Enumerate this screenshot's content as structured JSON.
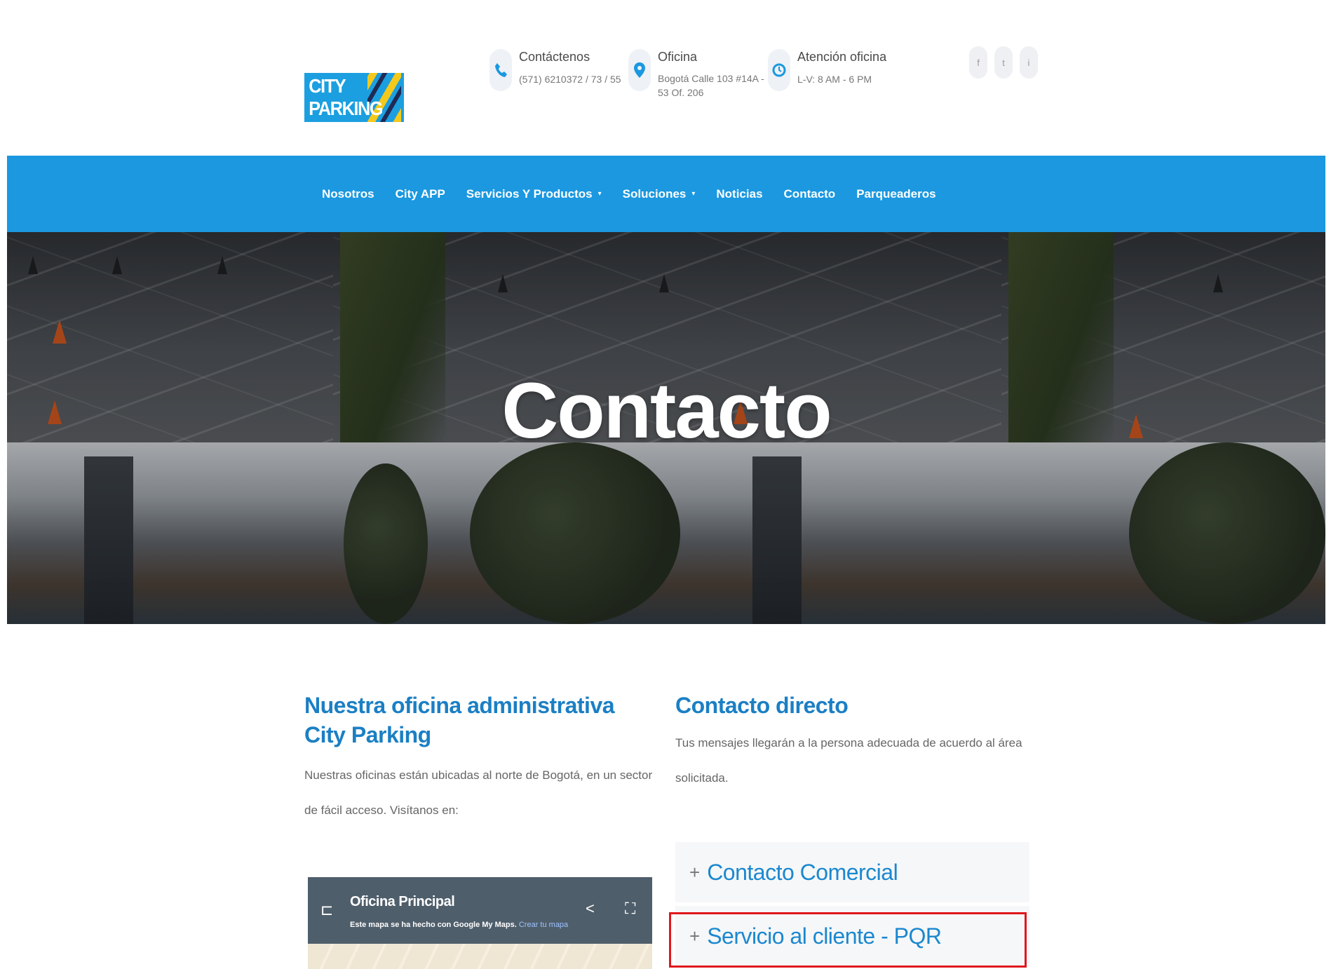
{
  "brand": {
    "logo_text": "CITY PARKING"
  },
  "header": {
    "contact": {
      "title": "Contáctenos",
      "value": "(571) 6210372 / 73 / 55"
    },
    "office": {
      "title": "Oficina",
      "value_line1": "Bogotá Calle 103 #14A -",
      "value_line2": "53 Of. 206"
    },
    "hours": {
      "title": "Atención oficina",
      "value": "L-V: 8 AM - 6 PM"
    },
    "social": {
      "facebook": "f",
      "twitter": "t",
      "instagram": "i"
    }
  },
  "nav": {
    "items": [
      {
        "label": "Nosotros"
      },
      {
        "label": "City APP"
      },
      {
        "label": "Servicios Y Productos",
        "caret": "▾"
      },
      {
        "label": "Soluciones",
        "caret": "▾"
      },
      {
        "label": "Noticias"
      },
      {
        "label": "Contacto",
        "active": true
      },
      {
        "label": "Parqueaderos"
      }
    ]
  },
  "hero": {
    "title": "Contacto"
  },
  "left": {
    "heading": "Nuestra oficina administrativa City Parking",
    "text": "Nuestras oficinas están ubicadas al norte de Bogotá, en un sector de fácil acceso. Visítanos en:",
    "map": {
      "title": "Oficina Principal",
      "note": "Este mapa se ha hecho con Google My Maps.",
      "note_link": "Crear tu mapa"
    }
  },
  "right": {
    "heading": "Contacto directo",
    "text": "Tus mensajes llegarán a la persona adecuada de acuerdo al área solicitada.",
    "accordion": [
      {
        "label": "Contacto Comercial"
      },
      {
        "label": "Servicio al cliente - PQR"
      }
    ]
  },
  "colors": {
    "brand_blue": "#1b98e0",
    "heading_blue": "#1b7fc4",
    "highlight_red": "#e0171d"
  }
}
